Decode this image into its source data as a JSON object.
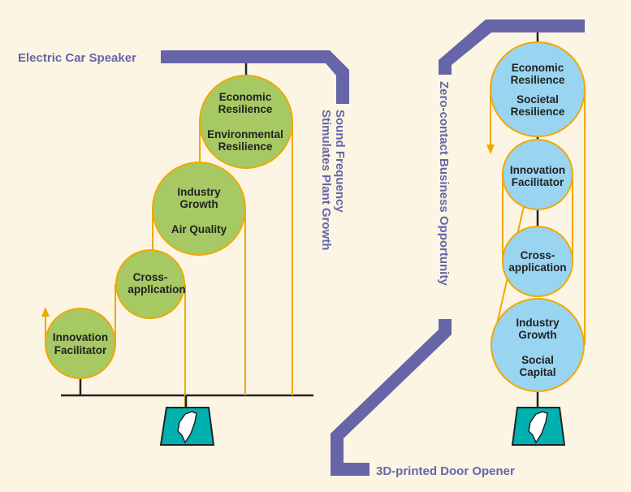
{
  "colors": {
    "background": "#fdf5e4",
    "band": "#6665a8",
    "green_circle": "#a6c964",
    "blue_circle": "#99d5f0",
    "rope": "#f0a800",
    "weight": "#00b1b0"
  },
  "left": {
    "title": "Electric Car Speaker",
    "side_line1": "Sound Frequency",
    "side_line2": "Stimulates Plant Growth",
    "circles": [
      {
        "lines": [
          "Innovation",
          "Facilitator"
        ]
      },
      {
        "lines": [
          "Cross-",
          "application"
        ]
      },
      {
        "lines": [
          "Industry",
          "Growth",
          "Air Quality"
        ]
      },
      {
        "lines": [
          "Economic",
          "Resilience",
          "Environmental",
          "Resilience"
        ]
      }
    ]
  },
  "right": {
    "side_text": "Zero-contact Business Opportunity",
    "bottom_title": "3D-printed Door Opener",
    "circles": [
      {
        "lines": [
          "Economic",
          "Resilience",
          "Societal",
          "Resilience"
        ]
      },
      {
        "lines": [
          "Innovation",
          "Facilitator"
        ]
      },
      {
        "lines": [
          "Cross-",
          "application"
        ]
      },
      {
        "lines": [
          "Industry",
          "Growth",
          "Social",
          "Capital"
        ]
      }
    ]
  },
  "icons": [
    "taiwan-map-weight-icon"
  ]
}
